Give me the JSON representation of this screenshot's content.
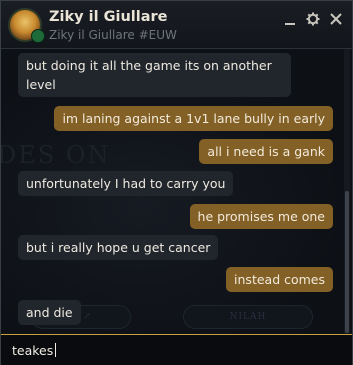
{
  "header": {
    "name": "Ziky il Giullare",
    "riot_id": "Ziky il Giullare #EUW",
    "icons": [
      "minimize-icon",
      "settings-gear-icon",
      "close-icon"
    ]
  },
  "background": {
    "text": "DES ON",
    "pill_left": "H ↗",
    "pill_right": "NILAH"
  },
  "messages": [
    {
      "side": "in",
      "text": "but doing it all the game its on another level"
    },
    {
      "side": "out",
      "text": "im laning against a 1v1 lane bully in early"
    },
    {
      "side": "out",
      "text": "all i need is a gank"
    },
    {
      "side": "in",
      "text": "unfortunately I had to carry you"
    },
    {
      "side": "out",
      "text": "he promises me one"
    },
    {
      "side": "in",
      "text": "but i really hope u get cancer"
    },
    {
      "side": "out",
      "text": "instead comes"
    },
    {
      "side": "in",
      "text": "and die"
    }
  ],
  "input": {
    "value": "teakes"
  },
  "colors": {
    "incoming_bubble": "#21262d",
    "outgoing_bubble": "#826026",
    "accent_gold": "#c7a040"
  }
}
